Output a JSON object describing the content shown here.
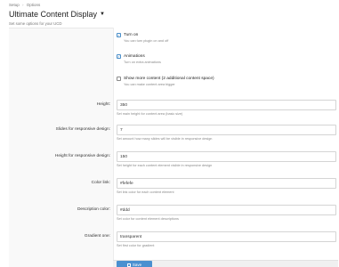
{
  "breadcrumb": {
    "items": [
      "Setup",
      "Options"
    ],
    "separator": "›"
  },
  "page": {
    "title": "Ultimate Content Display",
    "caret": "▼",
    "description": "Set some options for your UCD"
  },
  "options": [
    {
      "label": "Turn on",
      "checked": true,
      "hint": "You can turn plugin on and off"
    },
    {
      "label": "Animations",
      "checked": true,
      "hint": "Turn on extra animations"
    },
    {
      "label": "Show more content (2 additional content space)",
      "checked": false,
      "hint": "You can make content area bigger"
    }
  ],
  "fields": [
    {
      "label": "Height:",
      "value": "350",
      "hint": "Set main height for content area (basic size)"
    },
    {
      "label": "Slides for responsive design:",
      "value": "7",
      "hint": "Set amount how many slides will be visible in responsive design"
    },
    {
      "label": "Height for responsive design:",
      "value": "150",
      "hint": "Set height for each content element visible in responsive design"
    },
    {
      "label": "Color link:",
      "value": "#fefefe",
      "hint": "Set link color for each content element"
    },
    {
      "label": "Description color:",
      "value": "#ddd",
      "hint": "Set color for content element descriptions"
    },
    {
      "label": "Gradient one:",
      "value": "transparent",
      "hint": "Set first color for gradient"
    }
  ],
  "save_button": {
    "label": "Save",
    "icon": "save-icon"
  },
  "colors": {
    "accent": "#4a90d0",
    "checkbox": "#4a8fca"
  }
}
